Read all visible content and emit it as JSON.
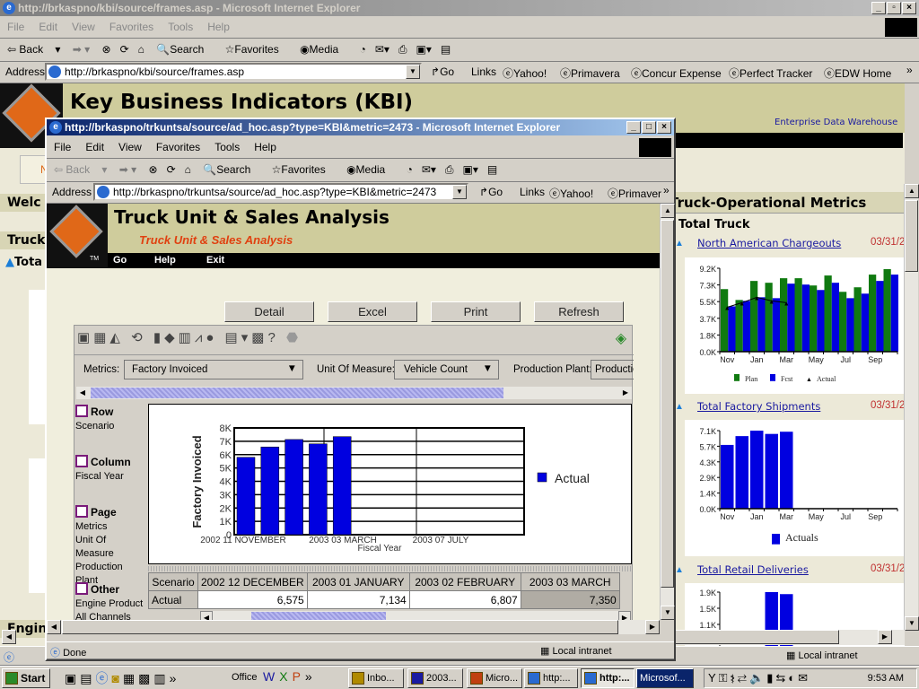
{
  "back_window": {
    "title": "http://brkaspno/kbi/source/frames.asp - Microsoft Internet Explorer",
    "menu": [
      "File",
      "Edit",
      "View",
      "Favorites",
      "Tools",
      "Help"
    ],
    "toolbar": {
      "back": "Back",
      "search": "Search",
      "favorites": "Favorites",
      "media": "Media"
    },
    "address_label": "Address",
    "address": "http://brkaspno/kbi/source/frames.asp",
    "go": "Go",
    "links_label": "Links",
    "links": [
      "Yahoo!",
      "Primavera",
      "Concur Expense",
      "Perfect Tracker",
      "EDW Home"
    ],
    "page": {
      "title": "Key Business Indicators (KBI)",
      "edw": "Enterprise Data Warehouse",
      "left_welcome": "Welc",
      "left_truck": "Truck",
      "left_total": "Tota",
      "left_engine": "Engin",
      "section_title": "Truck-Operational Metrics",
      "group_title": "Total Truck",
      "metrics": [
        {
          "label": "North American Chargeouts",
          "date": "03/31/2"
        },
        {
          "label": "Total Factory Shipments",
          "date": "03/31/2"
        },
        {
          "label": "Total Retail Deliveries",
          "date": "03/31/2"
        }
      ]
    },
    "status": "Local intranet"
  },
  "front_window": {
    "title": "http://brkaspno/trkuntsa/source/ad_hoc.asp?type=KBI&metric=2473 - Microsoft Internet Explorer",
    "menu": [
      "File",
      "Edit",
      "View",
      "Favorites",
      "Tools",
      "Help"
    ],
    "toolbar": {
      "back": "Back",
      "search": "Search",
      "favorites": "Favorites",
      "media": "Media"
    },
    "address_label": "Address",
    "address": "http://brkaspno/trkuntsa/source/ad_hoc.asp?type=KBI&metric=2473",
    "go": "Go",
    "links_label": "Links",
    "links": [
      "Yahoo!",
      "Primavera"
    ],
    "page": {
      "title": "Truck Unit & Sales Analysis",
      "subtitle": "Truck Unit & Sales Analysis",
      "nav": [
        "Go",
        "Help",
        "Exit"
      ],
      "buttons": [
        "Detail",
        "Excel",
        "Print",
        "Refresh"
      ],
      "filters": {
        "metrics_label": "Metrics:",
        "metrics_value": "Factory Invoiced",
        "uom_label": "Unit Of Measure:",
        "uom_value": "Vehicle Count",
        "plant_label": "Production Plant:",
        "plant_value": "Production"
      },
      "pivot": {
        "row": {
          "title": "Row",
          "items": [
            "Scenario"
          ]
        },
        "column": {
          "title": "Column",
          "items": [
            "Fiscal Year"
          ]
        },
        "page": {
          "title": "Page",
          "items": [
            "Metrics",
            "Unit Of Measure",
            "Production Plant"
          ]
        },
        "other": {
          "title": "Other",
          "items": [
            "Engine Product",
            "All Channels"
          ]
        }
      },
      "table": {
        "corner": "Scenario",
        "columns": [
          "2002 12 DECEMBER",
          "2003 01 JANUARY",
          "2003 02 FEBRUARY",
          "2003 03 MARCH"
        ],
        "rows": [
          {
            "label": "Actual",
            "values": [
              "6,575",
              "7,134",
              "6,807",
              "7,350"
            ]
          }
        ]
      }
    },
    "status_left": "Done",
    "status_zone": "Local intranet"
  },
  "chart_data": [
    {
      "type": "bar",
      "ylabel": "Factory Invoiced",
      "xlabel": "Fiscal Year",
      "xtick_labels": [
        "2002 11 NOVEMBER",
        "2003 03 MARCH",
        "2003 07 JULY"
      ],
      "ytick_labels": [
        "0",
        "1K",
        "2K",
        "3K",
        "4K",
        "5K",
        "6K",
        "7K",
        "8K"
      ],
      "ylim": [
        0,
        8000
      ],
      "grid": true,
      "legend": "right",
      "categories": [
        "2002 11 NOVEMBER",
        "2002 12 DECEMBER",
        "2003 01 JANUARY",
        "2003 02 FEBRUARY",
        "2003 03 MARCH"
      ],
      "series": [
        {
          "name": "Actual",
          "color": "#0000e0",
          "values": [
            5800,
            6575,
            7134,
            6807,
            7350
          ]
        }
      ]
    },
    {
      "type": "bar",
      "ytick_labels": [
        "0.0K",
        "1.8K",
        "3.7K",
        "5.5K",
        "7.3K",
        "9.2K"
      ],
      "ylim": [
        0,
        9.2
      ],
      "xtick_labels": [
        "Nov",
        "Jan",
        "Mar",
        "May",
        "Jul",
        "Sep"
      ],
      "categories": [
        "Nov",
        "Dec",
        "Jan",
        "Feb",
        "Mar",
        "Apr",
        "May",
        "Jun",
        "Jul",
        "Aug",
        "Sep",
        "Oct"
      ],
      "legend": "bottom",
      "series": [
        {
          "name": "Plan",
          "color": "#107a10",
          "values": [
            6.9,
            5.7,
            7.8,
            7.6,
            8.1,
            8.1,
            7.3,
            8.4,
            6.6,
            7.1,
            8.5,
            9.1
          ]
        },
        {
          "name": "Fcst",
          "color": "#0000e0",
          "values": [
            5.0,
            5.6,
            6.0,
            5.9,
            7.5,
            7.4,
            6.8,
            7.6,
            5.9,
            6.4,
            7.8,
            8.5
          ]
        },
        {
          "name": "Actual",
          "type": "line",
          "color": "#000000",
          "values": [
            4.9,
            5.4,
            6.0,
            5.6,
            5.4
          ]
        }
      ]
    },
    {
      "type": "bar",
      "ytick_labels": [
        "0.0K",
        "1.4K",
        "2.9K",
        "4.3K",
        "5.7K",
        "7.1K"
      ],
      "ylim": [
        0,
        7.1
      ],
      "xtick_labels": [
        "Nov",
        "Jan",
        "Mar",
        "May",
        "Jul",
        "Sep"
      ],
      "categories": [
        "Nov",
        "Dec",
        "Jan",
        "Feb",
        "Mar",
        "Apr",
        "May",
        "Jun",
        "Jul",
        "Aug",
        "Sep",
        "Oct"
      ],
      "legend": "bottom",
      "series": [
        {
          "name": "Actuals",
          "color": "#0000e0",
          "values": [
            5.8,
            6.6,
            7.1,
            6.8,
            7.0
          ]
        }
      ]
    },
    {
      "type": "bar",
      "ytick_labels": [
        "1.1K",
        "1.5K",
        "1.9K"
      ],
      "ylim": [
        1.1,
        1.9
      ],
      "categories": [
        "Nov",
        "Dec",
        "Jan",
        "Feb",
        "Mar"
      ],
      "series": [
        {
          "values": [
            null,
            null,
            null,
            1.9,
            1.85
          ],
          "color": "#0000e0"
        }
      ]
    }
  ],
  "taskbar": {
    "start": "Start",
    "office": "Office",
    "tasks": [
      "Inbo...",
      "2003...",
      "Micro...",
      "http:...",
      "http:...",
      "Microsof..."
    ],
    "clock": "9:53 AM"
  }
}
